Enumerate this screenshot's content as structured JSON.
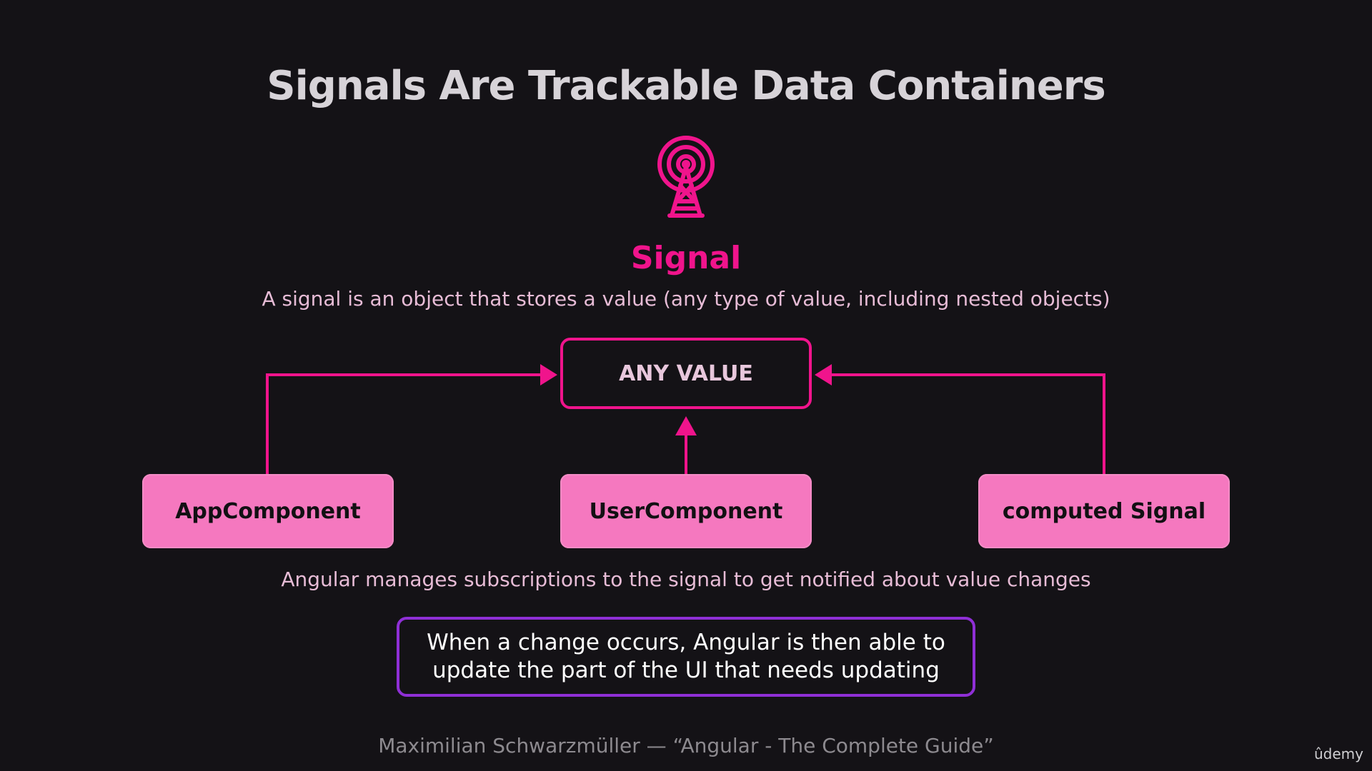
{
  "slide": {
    "title": "Signals Are Trackable Data Containers",
    "icon": "radio-tower-icon",
    "signal_heading": "Signal",
    "signal_description": "A signal is an object that stores a value (any type of value, including nested objects)",
    "central_value": "ANY VALUE",
    "consumers": [
      "AppComponent",
      "UserComponent",
      "computed Signal"
    ],
    "subscription_text": "Angular manages subscriptions to the signal to get notified about value changes",
    "change_text_line1": "When a change occurs, Angular is then able to",
    "change_text_line2": "update the part of the UI that needs updating",
    "footer": "Maximilian Schwarzmüller — “Angular - The Complete Guide”",
    "watermark": "ûdemy"
  },
  "colors": {
    "accent_pink": "#f0148c",
    "box_pink": "#f578bf",
    "purple_border": "#8f2fd6",
    "background": "#141216"
  }
}
